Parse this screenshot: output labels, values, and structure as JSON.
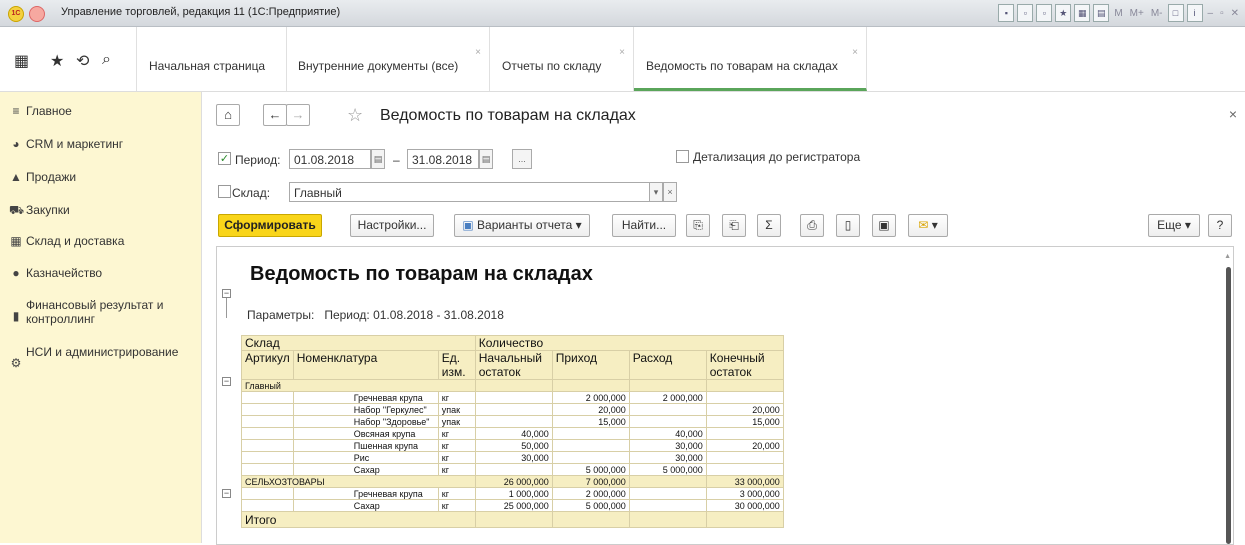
{
  "window": {
    "title": "Управление торговлей, редакция 11  (1С:Предприятие)",
    "logo_text": "1С",
    "toolbar_text": [
      "M",
      "M+",
      "M-"
    ]
  },
  "tabs": [
    {
      "label": "Начальная страница"
    },
    {
      "label": "Внутренние документы (все)"
    },
    {
      "label": "Отчеты по складу"
    },
    {
      "label": "Ведомость по товарам на складах"
    }
  ],
  "sidebar": {
    "items": [
      {
        "label": "Главное",
        "icon": "menu-lines-icon"
      },
      {
        "label": "CRM и маркетинг",
        "icon": "pie-icon"
      },
      {
        "label": "Продажи",
        "icon": "bag-icon"
      },
      {
        "label": "Закупки",
        "icon": "cart-icon"
      },
      {
        "label": "Склад и доставка",
        "icon": "warehouse-icon"
      },
      {
        "label": "Казначейство",
        "icon": "coin-icon"
      },
      {
        "label": "Финансовый результат и контроллинг",
        "icon": "bar-chart-icon"
      },
      {
        "label": "НСИ и администрирование",
        "icon": "gear-icon"
      }
    ]
  },
  "form": {
    "title": "Ведомость по товарам на складах",
    "period_label": "Период:",
    "period_from": "01.08.2018",
    "period_dash": "–",
    "period_to": "31.08.2018",
    "period_more": "...",
    "detail_label": "Детализация до регистратора",
    "sklad_label": "Склад:",
    "sklad_value": "Главный",
    "buttons": {
      "generate": "Сформировать",
      "settings": "Настройки...",
      "variants": "Варианты отчета",
      "find": "Найти...",
      "sum": "Σ",
      "more": "Еще",
      "help": "?"
    }
  },
  "report": {
    "title": "Ведомость по товарам на складах",
    "params_label": "Параметры:",
    "params_value": "Период: 01.08.2018 - 31.08.2018",
    "headers": {
      "sklad": "Склад",
      "artikul": "Артикул",
      "nomenklatura": "Номенклатура",
      "ed1": "Ед.",
      "ed2": "изм.",
      "kolichestvo": "Количество",
      "nach1": "Начальный",
      "nach2": "остаток",
      "prihod": "Приход",
      "rashod": "Расход",
      "kon1": "Конечный",
      "kon2": "остаток"
    },
    "groups": [
      {
        "name": "Главный",
        "start": "",
        "in": "",
        "out": "",
        "end": "",
        "rows": [
          {
            "name": "Гречневая крупа",
            "unit": "кг",
            "start": "",
            "in": "2 000,000",
            "out": "2 000,000",
            "end": ""
          },
          {
            "name": "Набор \"Геркулес\"",
            "unit": "упак",
            "start": "",
            "in": "20,000",
            "out": "",
            "end": "20,000"
          },
          {
            "name": "Набор \"Здоровье\"",
            "unit": "упак",
            "start": "",
            "in": "15,000",
            "out": "",
            "end": "15,000"
          },
          {
            "name": "Овсяная крупа",
            "unit": "кг",
            "start": "40,000",
            "in": "",
            "out": "40,000",
            "end": ""
          },
          {
            "name": "Пшенная крупа",
            "unit": "кг",
            "start": "50,000",
            "in": "",
            "out": "30,000",
            "end": "20,000"
          },
          {
            "name": "Рис",
            "unit": "кг",
            "start": "30,000",
            "in": "",
            "out": "30,000",
            "end": ""
          },
          {
            "name": "Сахар",
            "unit": "кг",
            "start": "",
            "in": "5 000,000",
            "out": "5 000,000",
            "end": ""
          }
        ]
      },
      {
        "name": "СЕЛЬХОЗТОВАРЫ",
        "start": "26 000,000",
        "in": "7 000,000",
        "out": "",
        "end": "33 000,000",
        "rows": [
          {
            "name": "Гречневая крупа",
            "unit": "кг",
            "start": "1 000,000",
            "in": "2 000,000",
            "out": "",
            "end": "3 000,000"
          },
          {
            "name": "Сахар",
            "unit": "кг",
            "start": "25 000,000",
            "in": "5 000,000",
            "out": "",
            "end": "30 000,000"
          }
        ]
      }
    ],
    "total_label": "Итого"
  }
}
